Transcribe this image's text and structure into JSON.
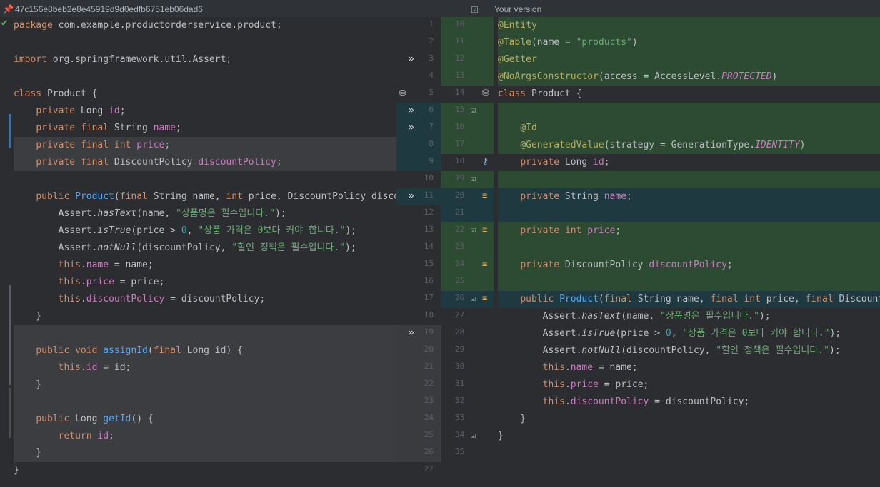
{
  "header": {
    "left_commit": "47c156e8beb2e8e45919d9d0edfb6751eb06dad6",
    "right_title": "Your version"
  },
  "left": {
    "lines": [
      {
        "n": 1,
        "text": "package com.example.productorderservice.product;",
        "bg": ""
      },
      {
        "n": 2,
        "text": "",
        "bg": ""
      },
      {
        "n": 3,
        "text": "import org.springframework.util.Assert;",
        "bg": ""
      },
      {
        "n": 4,
        "text": "",
        "bg": ""
      },
      {
        "n": 5,
        "text": "class Product {",
        "bg": ""
      },
      {
        "n": 6,
        "text": "    private Long id;",
        "bg": ""
      },
      {
        "n": 7,
        "text": "    private final String name;",
        "bg": ""
      },
      {
        "n": 8,
        "text": "    private final int price;",
        "bg": "gray"
      },
      {
        "n": 9,
        "text": "    private final DiscountPolicy discountPolicy;",
        "bg": "gray"
      },
      {
        "n": 10,
        "text": "",
        "bg": ""
      },
      {
        "n": 11,
        "text": "    public Product(final String name, int price, DiscountPolicy discountPolicy) {",
        "bg": ""
      },
      {
        "n": 12,
        "text": "        Assert.hasText(name, \"상품명은 필수입니다.\");",
        "bg": ""
      },
      {
        "n": 13,
        "text": "        Assert.isTrue(price > 0, \"상품 가격은 0보다 커야 합니다.\");",
        "bg": ""
      },
      {
        "n": 14,
        "text": "        Assert.notNull(discountPolicy, \"할인 정책은 필수입니다.\");",
        "bg": ""
      },
      {
        "n": 15,
        "text": "        this.name = name;",
        "bg": ""
      },
      {
        "n": 16,
        "text": "        this.price = price;",
        "bg": ""
      },
      {
        "n": 17,
        "text": "        this.discountPolicy = discountPolicy;",
        "bg": ""
      },
      {
        "n": 18,
        "text": "    }",
        "bg": ""
      },
      {
        "n": 19,
        "text": "",
        "bg": "gray"
      },
      {
        "n": 20,
        "text": "    public void assignId(final Long id) {",
        "bg": "gray"
      },
      {
        "n": 21,
        "text": "        this.id = id;",
        "bg": "gray"
      },
      {
        "n": 22,
        "text": "    }",
        "bg": "gray"
      },
      {
        "n": 23,
        "text": "",
        "bg": "gray"
      },
      {
        "n": 24,
        "text": "    public Long getId() {",
        "bg": "gray"
      },
      {
        "n": 25,
        "text": "        return id;",
        "bg": "gray"
      },
      {
        "n": 26,
        "text": "    }",
        "bg": "gray"
      },
      {
        "n": 27,
        "text": "}",
        "bg": ""
      }
    ]
  },
  "right": {
    "lines": [
      {
        "n": 10,
        "text": "@Entity",
        "bg": "added"
      },
      {
        "n": 11,
        "text": "@Table(name = \"products\")",
        "bg": "added"
      },
      {
        "n": 12,
        "text": "@Getter",
        "bg": "added"
      },
      {
        "n": 13,
        "text": "@NoArgsConstructor(access = AccessLevel.PROTECTED)",
        "bg": "added"
      },
      {
        "n": 14,
        "text": "class Product {",
        "bg": ""
      },
      {
        "n": 15,
        "text": "",
        "bg": "added"
      },
      {
        "n": 16,
        "text": "    @Id",
        "bg": "added"
      },
      {
        "n": 17,
        "text": "    @GeneratedValue(strategy = GenerationType.IDENTITY)",
        "bg": "added"
      },
      {
        "n": 18,
        "text": "    private Long id;",
        "bg": ""
      },
      {
        "n": 19,
        "text": "",
        "bg": "added"
      },
      {
        "n": 20,
        "text": "    private String name;",
        "bg": "changed"
      },
      {
        "n": 21,
        "text": "",
        "bg": "changed"
      },
      {
        "n": 22,
        "text": "    private int price;",
        "bg": "added"
      },
      {
        "n": 23,
        "text": "",
        "bg": "added"
      },
      {
        "n": 24,
        "text": "    private DiscountPolicy discountPolicy;",
        "bg": "added"
      },
      {
        "n": 25,
        "text": "",
        "bg": "added"
      },
      {
        "n": 26,
        "text": "    public Product(final String name, final int price, final DiscountPolicy discountPolicy) {",
        "bg": "changed"
      },
      {
        "n": 27,
        "text": "        Assert.hasText(name, \"상품명은 필수입니다.\");",
        "bg": ""
      },
      {
        "n": 28,
        "text": "        Assert.isTrue(price > 0, \"상품 가격은 0보다 커야 합니다.\");",
        "bg": ""
      },
      {
        "n": 29,
        "text": "        Assert.notNull(discountPolicy, \"할인 정책은 필수입니다.\");",
        "bg": ""
      },
      {
        "n": 30,
        "text": "        this.name = name;",
        "bg": ""
      },
      {
        "n": 31,
        "text": "        this.price = price;",
        "bg": ""
      },
      {
        "n": 32,
        "text": "        this.discountPolicy = discountPolicy;",
        "bg": ""
      },
      {
        "n": 33,
        "text": "    }",
        "bg": ""
      },
      {
        "n": 34,
        "text": "}",
        "bg": ""
      },
      {
        "n": 35,
        "text": "",
        "bg": ""
      }
    ],
    "gutter_icons": {
      "14": "database-icon",
      "15": "checkbox-icon",
      "18": "key-icon",
      "19": "checkbox-icon",
      "20": "column-icon",
      "22": "checkbox-column-icon",
      "24": "column-icon",
      "26": "checkbox-column-icon",
      "34": "checkbox-icon"
    }
  },
  "middle": {
    "numbers": [
      1,
      2,
      3,
      4,
      5,
      6,
      7,
      8,
      9,
      10,
      11,
      12,
      13,
      14,
      15,
      16,
      17,
      18,
      19,
      20,
      21,
      22,
      23,
      24,
      25,
      26,
      27
    ],
    "apply_markers_at": [
      3,
      6,
      7,
      11,
      19
    ],
    "db_marker_at": 5
  },
  "colors": {
    "added_bg": "#2d4a32",
    "changed_bg": "#1e3a40",
    "gray_bg": "#3b3d40",
    "keyword": "#cf8e6d",
    "annotation": "#b3ae60",
    "string": "#6aab73",
    "field": "#c77dbb",
    "function": "#56a8f5"
  }
}
